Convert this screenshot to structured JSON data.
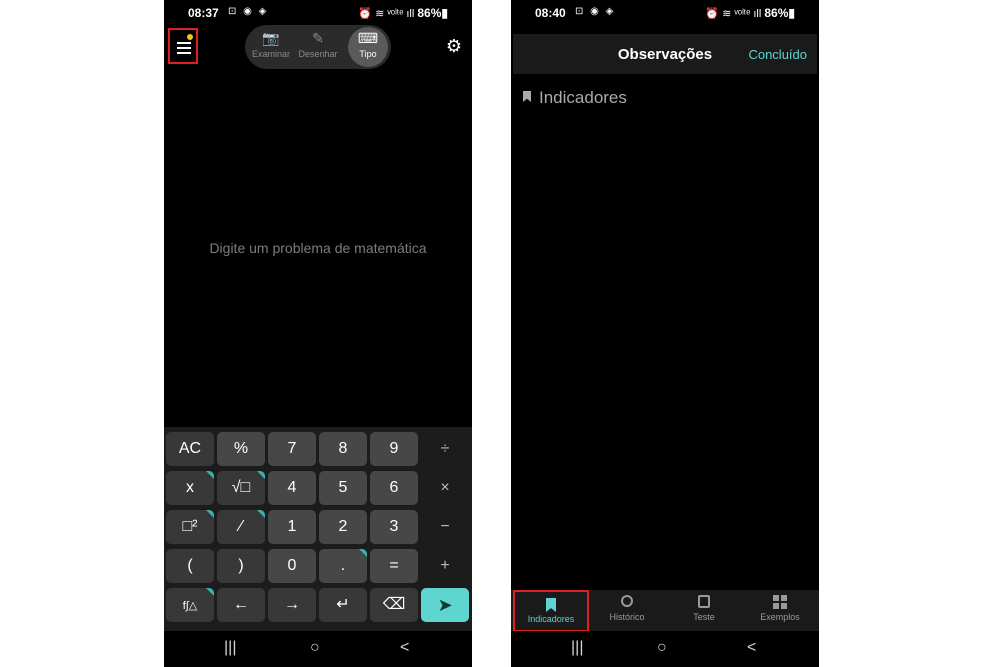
{
  "left": {
    "status": {
      "time": "08:37",
      "small_icons": "⊡ ◉ ◈",
      "right_icons": "⏰ ≋ ᵛᵒˡᵗᵉ ıll",
      "battery": "86%▮"
    },
    "modes": [
      {
        "label": "Examinar",
        "icon": "camera-icon",
        "glyph": "📷"
      },
      {
        "label": "Desenhar",
        "icon": "hand-draw-icon",
        "glyph": "✎"
      },
      {
        "label": "Tipo",
        "icon": "keyboard-icon",
        "glyph": "⌨"
      }
    ],
    "settings_glyph": "⚙",
    "prompt": "Digite um problema de matemática",
    "keys": [
      [
        "AC",
        "%",
        "7",
        "8",
        "9",
        "÷"
      ],
      [
        "x",
        "√□",
        "4",
        "5",
        "6",
        "×"
      ],
      [
        "□²",
        "⁄",
        "1",
        "2",
        "3",
        "−"
      ],
      [
        "(",
        ")",
        "0",
        ".",
        "=",
        "+"
      ],
      [
        "f∫△",
        "←",
        "→",
        "↵",
        "⌫",
        "➤"
      ]
    ]
  },
  "right": {
    "status": {
      "time": "08:40",
      "small_icons": "⊡ ◉ ◈",
      "right_icons": "⏰ ≋ ᵛᵒˡᵗᵉ ıll",
      "battery": "86%▮"
    },
    "header": {
      "title": "Observações",
      "done": "Concluído"
    },
    "section": "Indicadores",
    "tabs": [
      {
        "label": "Indicadores",
        "icon": "bookmark-icon"
      },
      {
        "label": "Histórico",
        "icon": "history-icon"
      },
      {
        "label": "Teste",
        "icon": "test-icon"
      },
      {
        "label": "Exemplos",
        "icon": "grid-icon"
      }
    ]
  },
  "navbar": {
    "recent": "|||",
    "home": "○",
    "back": "<"
  }
}
